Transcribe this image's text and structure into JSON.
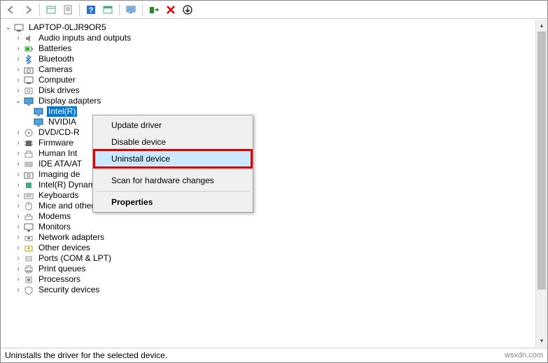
{
  "toolbar": {
    "back": "◄",
    "forward": "►",
    "help": "?",
    "close": "✕",
    "down": "⬇"
  },
  "root": {
    "label": "LAPTOP-0LJR9OR5"
  },
  "cats": {
    "audio": "Audio inputs and outputs",
    "batteries": "Batteries",
    "bluetooth": "Bluetooth",
    "cameras": "Cameras",
    "computer": "Computer",
    "disk": "Disk drives",
    "display": "Display adapters",
    "dvd": "DVD/CD-R",
    "firmware": "Firmware",
    "hid": "Human Int",
    "ide": "IDE ATA/AT",
    "imaging": "Imaging de",
    "dptf": "Intel(R) Dynamic Platform and Thermal Framework",
    "keyboards": "Keyboards",
    "mice": "Mice and other pointing devices",
    "modems": "Modems",
    "monitors": "Monitors",
    "network": "Network adapters",
    "other": "Other devices",
    "ports": "Ports (COM & LPT)",
    "printq": "Print queues",
    "processors": "Processors",
    "security": "Security devices"
  },
  "devices": {
    "intel": "Intel(R)",
    "nvidia": "NVIDIA"
  },
  "menu": {
    "update": "Update driver",
    "disable": "Disable device",
    "uninstall": "Uninstall device",
    "scan": "Scan for hardware changes",
    "properties": "Properties"
  },
  "status": "Uninstalls the driver for the selected device.",
  "watermark": "wsxdn.com"
}
